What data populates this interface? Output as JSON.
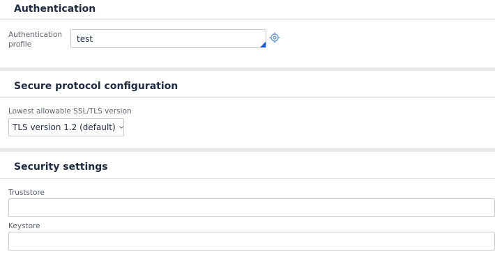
{
  "authentication": {
    "title": "Authentication",
    "profile_label_line1": "Authentication",
    "profile_label_line2": "profile",
    "profile_value": "test"
  },
  "secure_protocol": {
    "title": "Secure protocol configuration",
    "tls_label": "Lowest allowable SSL/TLS version",
    "tls_selected": "TLS version 1.2 (default)"
  },
  "security_settings": {
    "title": "Security settings",
    "truststore_label": "Truststore",
    "truststore_value": "",
    "keystore_label": "Keystore",
    "keystore_value": ""
  },
  "colors": {
    "accent": "#1a5bd6",
    "title_text": "#1f2a44",
    "label_text": "#5d6470",
    "divider": "#e7e7e7"
  },
  "icons": {
    "target": "crosshair-target-icon",
    "dropdown": "chevron-down-icon"
  }
}
